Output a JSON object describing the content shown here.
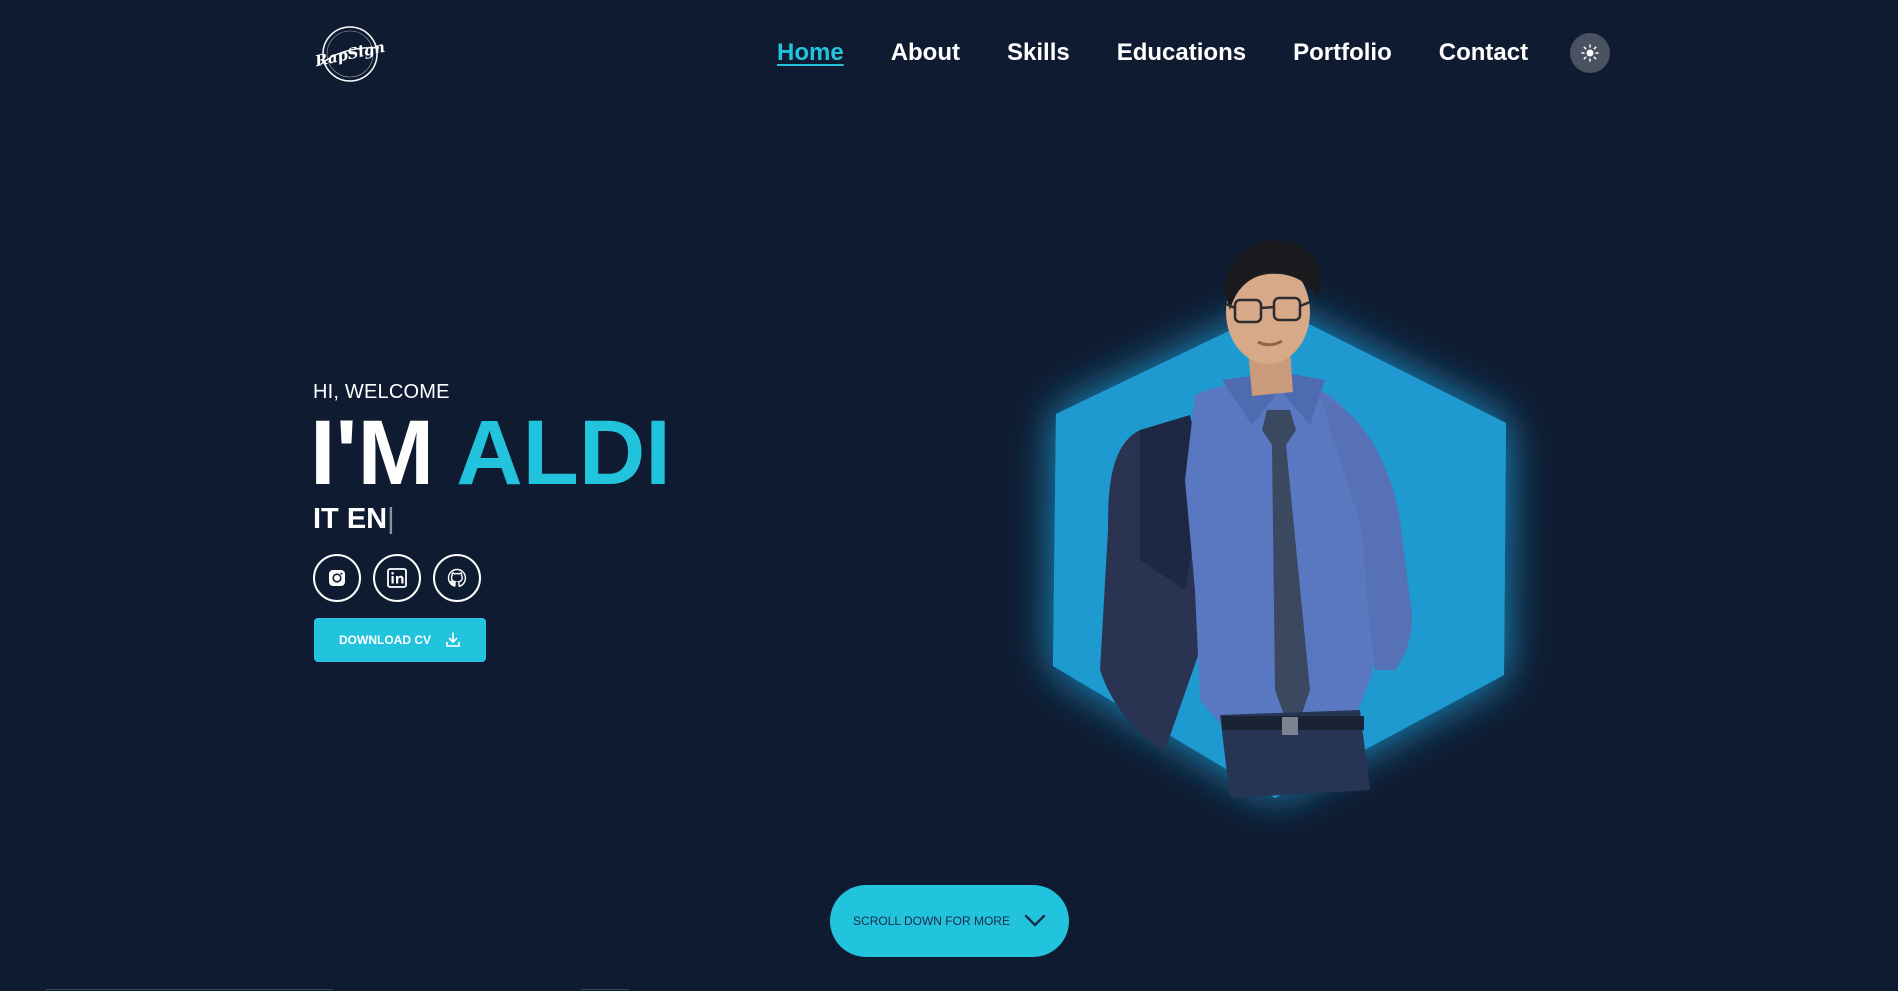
{
  "header": {
    "logo_text": "RapSign",
    "nav": [
      {
        "label": "Home",
        "active": true
      },
      {
        "label": "About",
        "active": false
      },
      {
        "label": "Skills",
        "active": false
      },
      {
        "label": "Educations",
        "active": false
      },
      {
        "label": "Portfolio",
        "active": false
      },
      {
        "label": "Contact",
        "active": false
      }
    ],
    "theme_toggle_icon": "sun-icon"
  },
  "hero": {
    "greeting": "HI, WELCOME",
    "headline_prefix": "I'M",
    "headline_name": "ALDI",
    "role_typed": "IT EN",
    "cursor": "|",
    "socials": [
      {
        "icon": "instagram-icon"
      },
      {
        "icon": "linkedin-icon"
      },
      {
        "icon": "github-icon"
      }
    ],
    "download_label": "DOWNLOAD CV",
    "download_icon": "download-icon"
  },
  "scroll": {
    "label": "SCROLL DOWN FOR MORE",
    "icon": "chevron-down-icon"
  },
  "colors": {
    "background": "#0f1b31",
    "accent": "#22c3dd",
    "hexagon": "#1e9ad1",
    "text": "#ffffff"
  }
}
